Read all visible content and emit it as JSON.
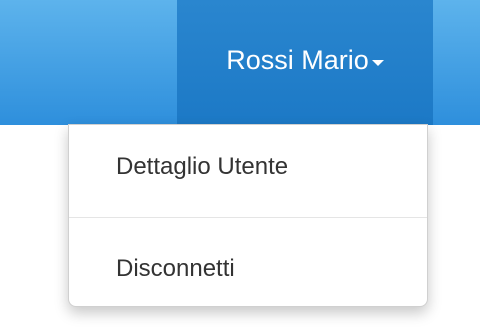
{
  "navbar": {
    "user_menu_label": "Rossi Mario"
  },
  "dropdown": {
    "items": [
      {
        "label": "Dettaglio Utente"
      },
      {
        "label": "Disconnetti"
      }
    ]
  }
}
